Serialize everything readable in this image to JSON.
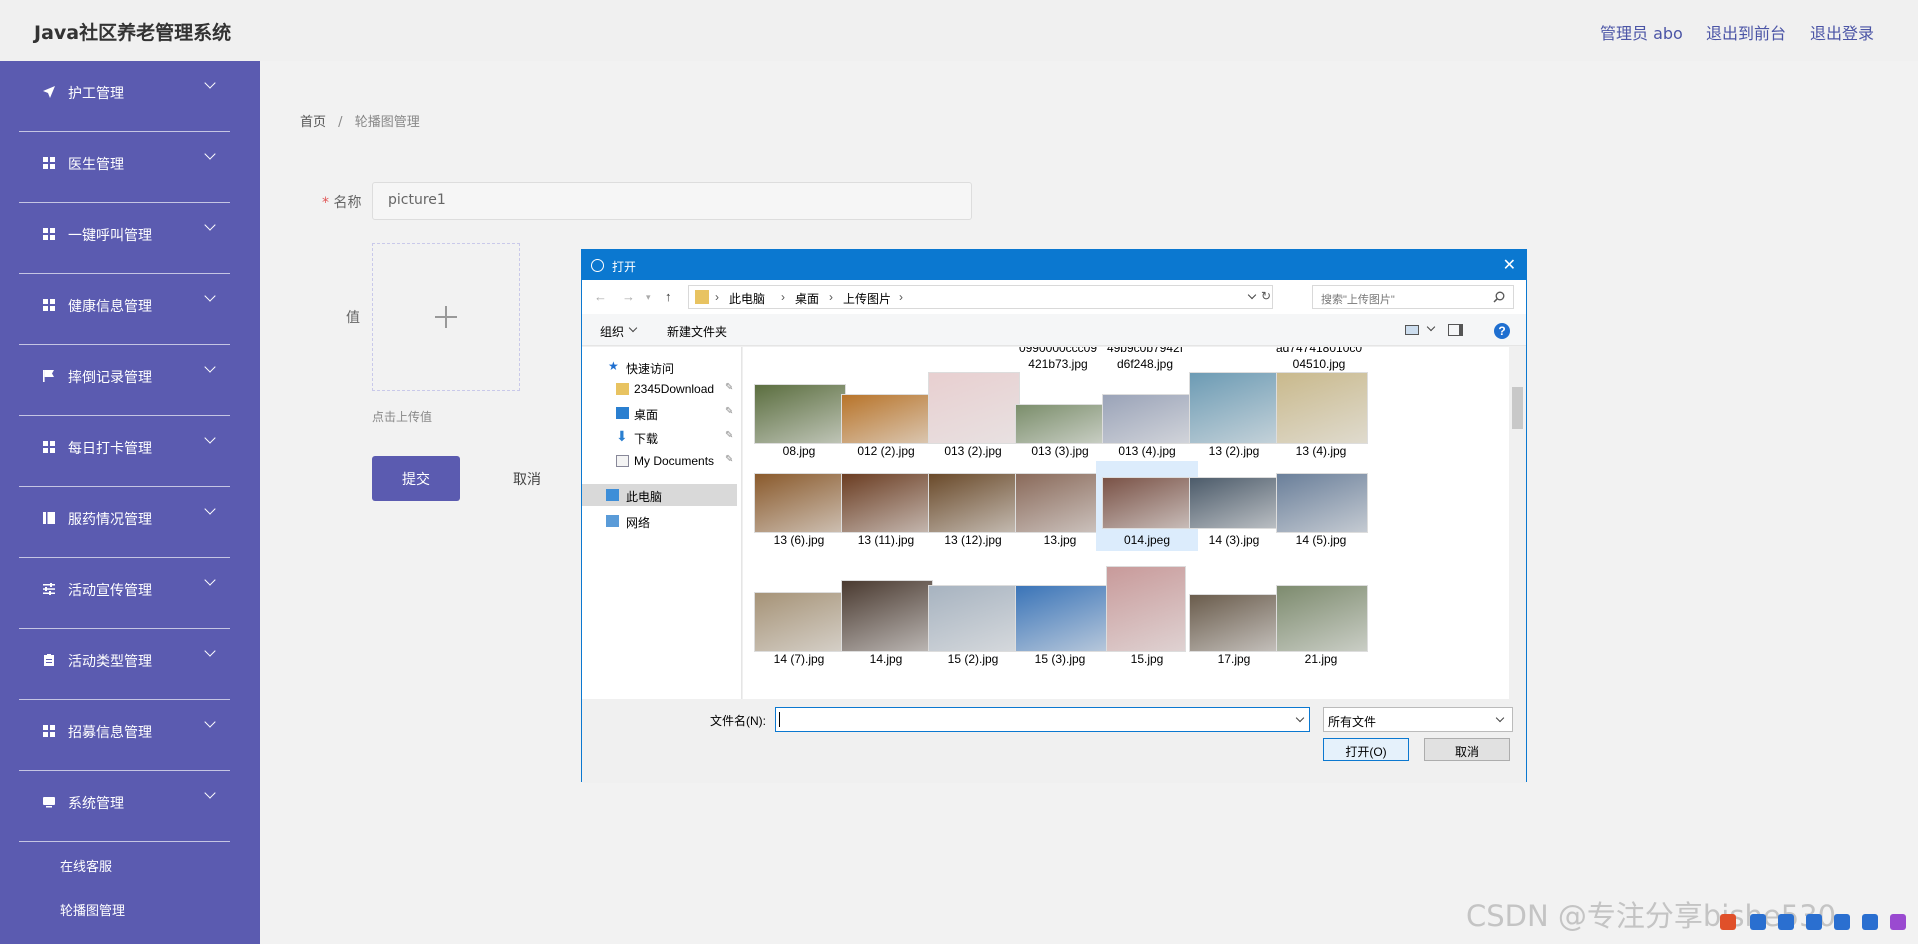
{
  "header": {
    "app_title": "Java社区养老管理系统",
    "admin_label": "管理员 abo",
    "front_link": "退出到前台",
    "logout_link": "退出登录"
  },
  "sidebar": {
    "items": [
      {
        "label": "护工管理",
        "icon": "send-icon"
      },
      {
        "label": "医生管理",
        "icon": "grid-icon"
      },
      {
        "label": "一键呼叫管理",
        "icon": "grid-icon"
      },
      {
        "label": "健康信息管理",
        "icon": "grid-icon"
      },
      {
        "label": "摔倒记录管理",
        "icon": "flag-icon"
      },
      {
        "label": "每日打卡管理",
        "icon": "grid-icon"
      },
      {
        "label": "服药情况管理",
        "icon": "book-icon"
      },
      {
        "label": "活动宣传管理",
        "icon": "sliders-icon"
      },
      {
        "label": "活动类型管理",
        "icon": "clipboard-icon"
      },
      {
        "label": "招募信息管理",
        "icon": "grid-icon"
      },
      {
        "label": "系统管理",
        "icon": "monitor-icon"
      }
    ],
    "sub_items": [
      "在线客服",
      "轮播图管理"
    ]
  },
  "breadcrumb": {
    "home": "首页",
    "separator": "/",
    "current": "轮播图管理"
  },
  "form": {
    "required_mark": "*",
    "name_label": "名称",
    "name_value": "picture1",
    "value_label": "值",
    "upload_hint": "点击上传值",
    "submit_label": "提交",
    "cancel_label": "取消"
  },
  "dialog": {
    "title": "打开",
    "close": "✕",
    "path": [
      "此电脑",
      "桌面",
      "上传图片"
    ],
    "search_placeholder": "搜索\"上传图片\"",
    "organize": "组织",
    "new_folder": "新建文件夹",
    "help": "?",
    "nav": [
      {
        "label": "快速访问",
        "icon": "star-icon",
        "pinned": false
      },
      {
        "label": "2345Download",
        "icon": "folder-icon",
        "pinned": true
      },
      {
        "label": "桌面",
        "icon": "desktop-icon",
        "pinned": true
      },
      {
        "label": "下载",
        "icon": "download-icon",
        "pinned": true
      },
      {
        "label": "My Documents",
        "icon": "documents-icon",
        "pinned": true
      },
      {
        "label": "此电脑",
        "icon": "computer-icon",
        "pinned": false
      },
      {
        "label": "网络",
        "icon": "network-icon",
        "pinned": false
      }
    ],
    "partial_files": [
      {
        "line1": "0990000ccc09",
        "line2": "421b73.jpg"
      },
      {
        "line1": "49b9c0b7942f",
        "line2": "d6f248.jpg"
      },
      {
        "line1": "ad747418010c0",
        "line2": "04510.jpg"
      }
    ],
    "files": [
      {
        "name": "08.jpg",
        "color": "#5b6e3f"
      },
      {
        "name": "012 (2).jpg",
        "color": "#b8742a"
      },
      {
        "name": "013 (2).jpg",
        "color": "#e8cfd0"
      },
      {
        "name": "013 (3).jpg",
        "color": "#7b8e6b"
      },
      {
        "name": "013 (4).jpg",
        "color": "#9aa3b8"
      },
      {
        "name": "13 (2).jpg",
        "color": "#6c9bb4"
      },
      {
        "name": "13 (4).jpg",
        "color": "#c9b98c"
      },
      {
        "name": "13 (6).jpg",
        "color": "#8a5a2c"
      },
      {
        "name": "13 (11).jpg",
        "color": "#6b3d22"
      },
      {
        "name": "13 (12).jpg",
        "color": "#6a4a2a"
      },
      {
        "name": "13.jpg",
        "color": "#8a6a5a"
      },
      {
        "name": "014.jpeg",
        "color": "#7a5246"
      },
      {
        "name": "14 (3).jpg",
        "color": "#4c5b6a"
      },
      {
        "name": "14 (5).jpg",
        "color": "#6a7f9a"
      },
      {
        "name": "14 (7).jpg",
        "color": "#a69377"
      },
      {
        "name": "14.jpg",
        "color": "#4a3a30"
      },
      {
        "name": "15 (2).jpg",
        "color": "#a7b3c0"
      },
      {
        "name": "15 (3).jpg",
        "color": "#3a74b8"
      },
      {
        "name": "15.jpg",
        "color": "#c89a9a"
      },
      {
        "name": "17.jpg",
        "color": "#6a5c4c"
      },
      {
        "name": "21.jpg",
        "color": "#7d8b6e"
      }
    ],
    "filename_label": "文件名(N):",
    "filetype": "所有文件",
    "open_label": "打开(O)",
    "cancel_label": "取消"
  },
  "watermark": "CSDN @专注分享bishe530"
}
